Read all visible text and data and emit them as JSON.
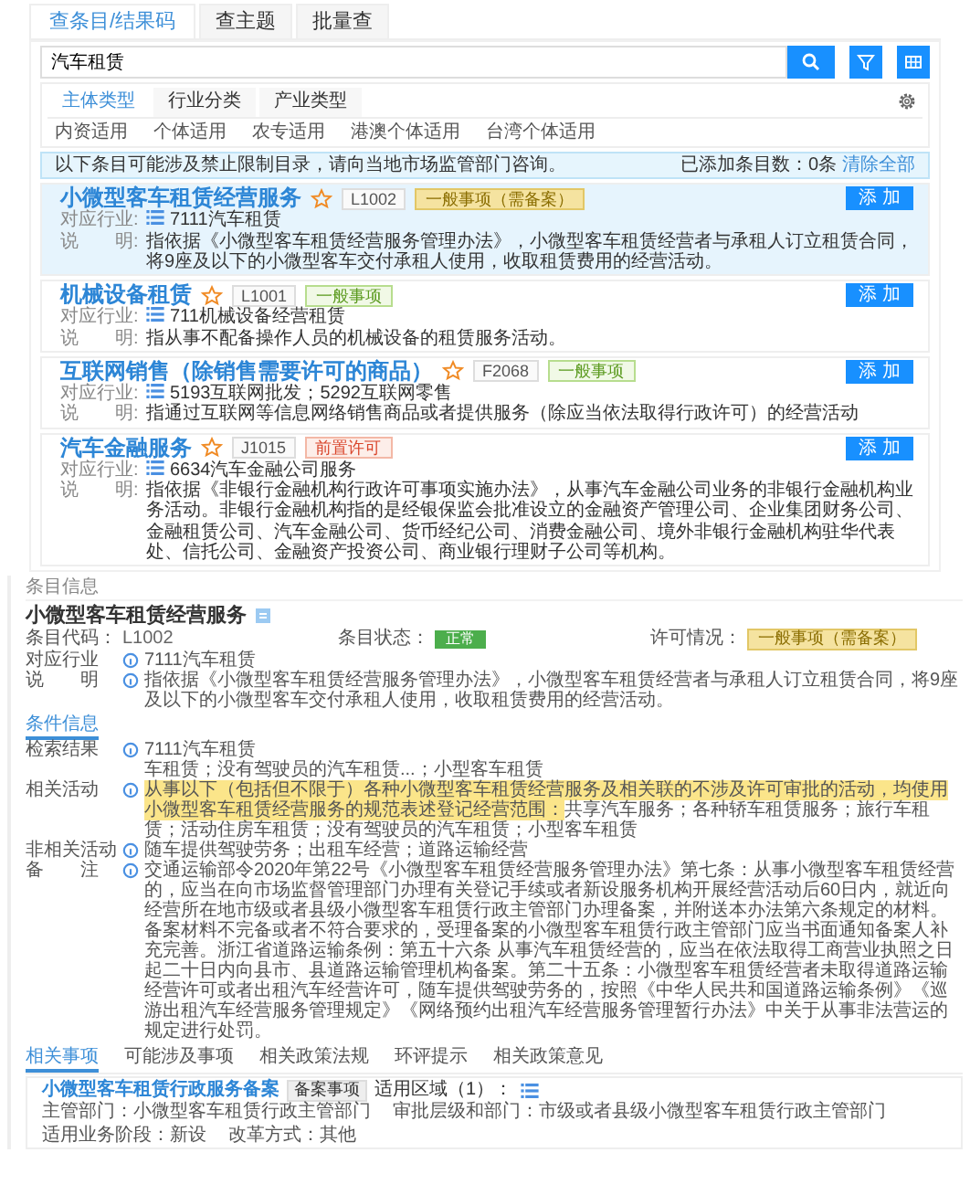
{
  "tabs": [
    {
      "label": "查条目/结果码",
      "selected": true
    },
    {
      "label": "查主题",
      "selected": false
    },
    {
      "label": "批量查",
      "selected": false
    }
  ],
  "search": {
    "value": "汽车租赁"
  },
  "filter_tabs": [
    {
      "label": "主体类型",
      "selected": true
    },
    {
      "label": "行业分类",
      "selected": false
    },
    {
      "label": "产业类型",
      "selected": false
    }
  ],
  "filter_options": [
    "内资适用",
    "个体适用",
    "农专适用",
    "港澳个体适用",
    "台湾个体适用"
  ],
  "notice": {
    "text": "以下条目可能涉及禁止限制目录，请向当地市场监管部门咨询。",
    "count": "已添加条目数：0条",
    "clear": "清除全部"
  },
  "results": [
    {
      "title": "小微型客车租赁经营服务",
      "code": "L1002",
      "tag": {
        "text": "一般事项（需备案）",
        "kind": "filing"
      },
      "selected": true,
      "industry_label": "对应行业:",
      "industry": "7111汽车租赁",
      "desc_label": "说　　明:",
      "desc": "指依据《小微型客车租赁经营服务管理办法》，小微型客车租赁经营者与承租人订立租赁合同，将9座及以下的小微型客车交付承租人使用，收取租赁费用的经营活动。",
      "add": "添 加"
    },
    {
      "title": "机械设备租赁",
      "code": "L1001",
      "tag": {
        "text": "一般事项",
        "kind": "general"
      },
      "selected": false,
      "industry_label": "对应行业:",
      "industry": "711机械设备经营租赁",
      "desc_label": "说　　明:",
      "desc": "指从事不配备操作人员的机械设备的租赁服务活动。",
      "add": "添 加"
    },
    {
      "title": "互联网销售（除销售需要许可的商品）",
      "code": "F2068",
      "tag": {
        "text": "一般事项",
        "kind": "general"
      },
      "selected": false,
      "industry_label": "对应行业:",
      "industry": "5193互联网批发；5292互联网零售",
      "desc_label": "说　　明:",
      "desc": "指通过互联网等信息网络销售商品或者提供服务（除应当依法取得行政许可）的经营活动",
      "add": "添 加"
    },
    {
      "title": "汽车金融服务",
      "code": "J1015",
      "tag": {
        "text": "前置许可",
        "kind": "permit"
      },
      "selected": false,
      "industry_label": "对应行业:",
      "industry": "6634汽车金融公司服务",
      "desc_label": "说　　明:",
      "desc": "指依据《非银行金融机构行政许可事项实施办法》，从事汽车金融公司业务的非银行金融机构业务活动。非银行金融机构指的是经银保监会批准设立的金融资产管理公司、企业集团财务公司、金融租赁公司、汽车金融公司、货币经纪公司、消费金融公司、境外非银行金融机构驻华代表处、信托公司、金融资产投资公司、商业银行理财子公司等机构。",
      "add": "添 加"
    }
  ],
  "detail": {
    "header": "条目信息",
    "title": "小微型客车租赁经营服务",
    "meta": [
      {
        "label": "条目代码：",
        "value": "L1002",
        "kind": "text"
      },
      {
        "label": "条目状态：",
        "value": "正常",
        "kind": "status"
      },
      {
        "label": "许可情况：",
        "value": "一般事项（需备案）",
        "kind": "filing"
      }
    ],
    "fields": [
      {
        "label": "对应行业",
        "value": "7111汽车租赁"
      },
      {
        "label": "说　　明",
        "value": "指依据《小微型客车租赁经营服务管理办法》，小微型客车租赁经营者与承租人订立租赁合同，将9座及以下的小微型客车交付承租人使用，收取租赁费用的经营活动。"
      }
    ],
    "section_tab": "条件信息",
    "rows": [
      {
        "label": "检索结果",
        "lines": [
          "7111汽车租赁",
          "车租赁；没有驾驶员的汽车租赁...；小型客车租赁"
        ]
      },
      {
        "label": "相关活动",
        "highlight": "从事以下（包括但不限于）各种小微型客车租赁经营服务及相关联的不涉及许可审批的活动，均使用小微型客车租赁经营服务的规范表述登记经营范围：",
        "value": "共享汽车服务；各种轿车租赁服务；旅行车租赁；活动住房车租赁；没有驾驶员的汽车租赁；小型客车租赁"
      },
      {
        "label": "非相关活动",
        "value": "随车提供驾驶劳务；出租车经营；道路运输经营"
      },
      {
        "label": "备　　注",
        "value": "交通运输部令2020年第22号《小微型客车租赁经营服务管理办法》第七条：从事小微型客车租赁经营的，应当在向市场监督管理部门办理有关登记手续或者新设服务机构开展经营活动后60日内，就近向经营所在地市级或者县级小微型客车租赁行政主管部门办理备案，并附送本办法第六条规定的材料。备案材料不完备或者不符合要求的，受理备案的小微型客车租赁行政主管部门应当书面通知备案人补充完善。浙江省道路运输条例：第五十六条 从事汽车租赁经营的，应当在依法取得工商营业执照之日起二十日内向县市、县道路运输管理机构备案。第二十五条：小微型客车租赁经营者未取得道路运输经营许可或者出租汽车经营许可，随车提供驾驶劳务的，按照《中华人民共和国道路运输条例》《巡游出租汽车经营服务管理规定》《网络预约出租汽车经营服务管理暂行办法》中关于从事非法营运的规定进行处罚。"
      }
    ],
    "bottom_tabs": [
      {
        "label": "相关事项",
        "selected": true
      },
      {
        "label": "可能涉及事项",
        "selected": false
      },
      {
        "label": "相关政策法规",
        "selected": false
      },
      {
        "label": "环评提示",
        "selected": false
      },
      {
        "label": "相关政策意见",
        "selected": false
      }
    ],
    "related": {
      "title": "小微型客车租赁行政服务备案",
      "tag": "备案事项",
      "region": "适用区域（1）：",
      "fields": [
        "主管部门：小微型客车租赁行政主管部门",
        "审批层级和部门：市级或者县级小微型客车租赁行政主管部门",
        "适用业务阶段：新设",
        "改革方式：其他"
      ]
    }
  }
}
